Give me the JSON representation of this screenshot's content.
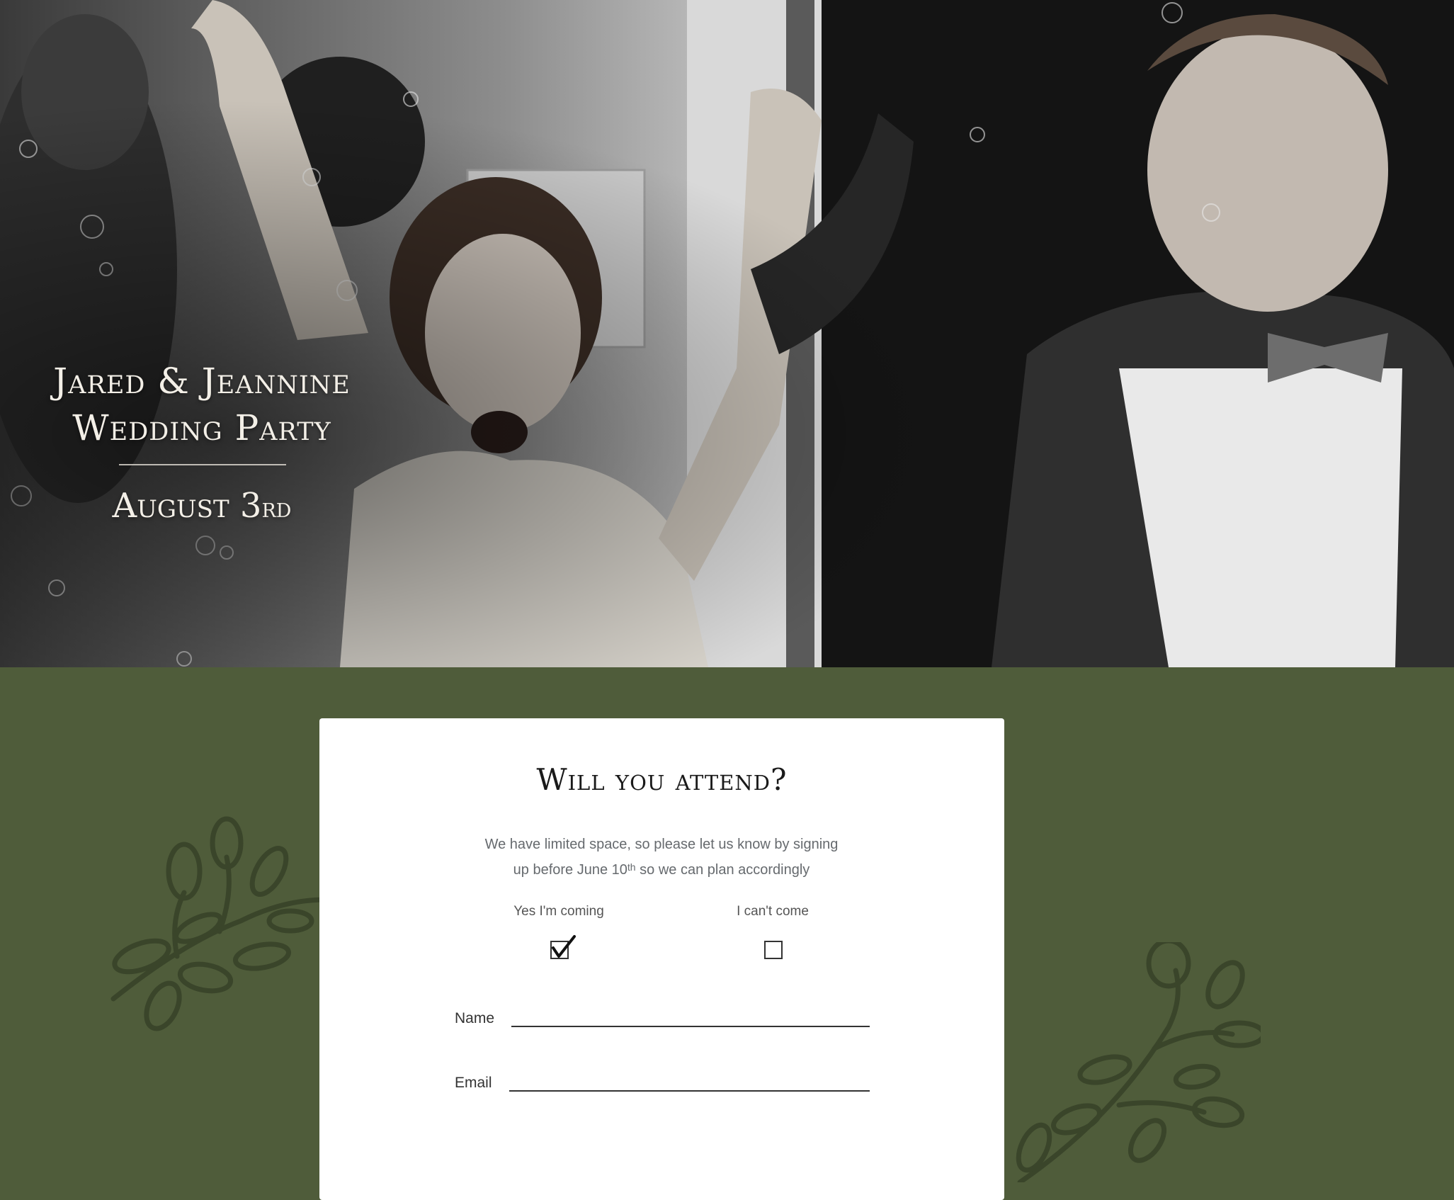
{
  "hero": {
    "title_line1": "Jared & Jeannine",
    "title_line2": "Wedding Party",
    "date_main": "August 3",
    "date_suffix": "rd",
    "image_alt": "Black and white photo of bride and groom celebrating with raised joined hands among bubbles"
  },
  "rsvp": {
    "title": "Will you attend?",
    "desc_line1": "We have limited space, so please let us know by signing",
    "desc_line2_pre": "up before June 10",
    "desc_line2_sup": "th",
    "desc_line2_post": " so we can plan accordingly",
    "options": {
      "yes_label": "Yes I'm coming",
      "yes_checked": true,
      "no_label": "I can't come",
      "no_checked": false
    },
    "fields": {
      "name_label": "Name",
      "name_value": "",
      "email_label": "Email",
      "email_value": ""
    }
  },
  "colors": {
    "background": "#4f5c3a",
    "leaf": "#3a452a",
    "card": "#ffffff",
    "text_dark": "#1a1a1a"
  }
}
